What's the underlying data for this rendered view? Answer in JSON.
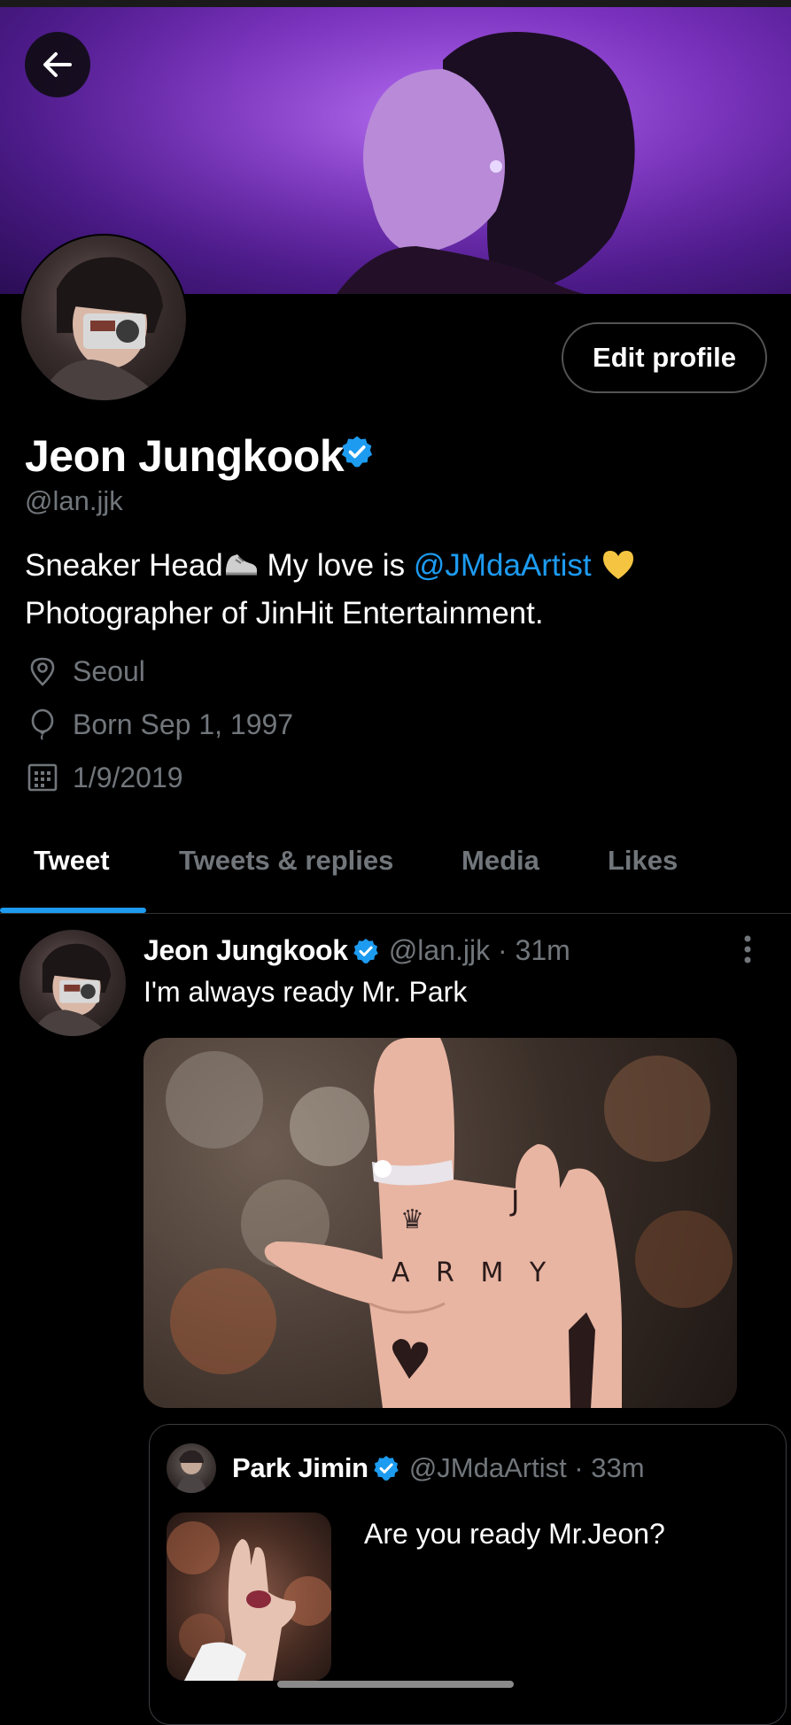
{
  "profile": {
    "name": "Jeon Jungkook",
    "handle": "@lan.jjk",
    "edit_button": "Edit profile",
    "bio_part1": "Sneaker Head",
    "bio_part2": " My love is ",
    "bio_mention": "@JMdaArtist",
    "bio_line2": "Photographer of JinHit Entertainment.",
    "location": "Seoul",
    "born": "Born Sep 1, 1997",
    "joined": "1/9/2019"
  },
  "tabs": [
    {
      "label": "Tweet",
      "active": true
    },
    {
      "label": "Tweets & replies",
      "active": false
    },
    {
      "label": "Media",
      "active": false
    },
    {
      "label": "Likes",
      "active": false
    }
  ],
  "tweet": {
    "name": "Jeon Jungkook",
    "handle_time": "@lan.jjk · 31m",
    "text": "I'm always ready Mr. Park",
    "image_text": {
      "letter_j": "J",
      "army": "A R M Y",
      "crown": "♛"
    }
  },
  "quoted": {
    "name": "Park Jimin",
    "handle_time": "@JMdaArtist · 33m",
    "text": "Are you ready Mr.Jeon?"
  },
  "colors": {
    "accent": "#1d9bf0",
    "muted": "#71767b",
    "banner": "#7b2fc0",
    "heart_emoji": "#f5c542"
  },
  "icons": [
    "back-arrow-icon",
    "verified-badge-icon",
    "location-pin-icon",
    "balloon-icon",
    "calendar-icon",
    "more-options-icon",
    "sneaker-icon",
    "yellow-heart-icon"
  ]
}
